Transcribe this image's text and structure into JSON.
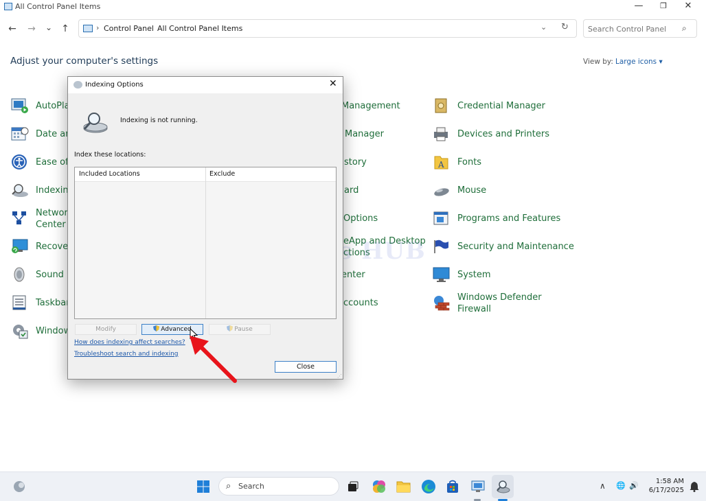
{
  "window": {
    "title": "All Control Panel Items",
    "minimize_glyph": "—",
    "maximize_glyph": "❐",
    "close_glyph": "✕"
  },
  "nav": {
    "back_glyph": "←",
    "forward_glyph": "→",
    "recent_glyph": "⌄",
    "up_glyph": "↑",
    "separator": "›",
    "breadcrumb": [
      "Control Panel",
      "All Control Panel Items"
    ],
    "dropdown_glyph": "⌄",
    "refresh_glyph": "↻",
    "search_placeholder": "Search Control Panel",
    "search_glyph": "⌕"
  },
  "header": {
    "title": "Adjust your computer's settings",
    "view_by_label": "View by:",
    "view_by_value": "Large icons ▾"
  },
  "items_left": [
    "AutoPlay",
    "Date and",
    "Ease of A",
    "Indexing",
    "Network\nCenter",
    "Recover",
    "Sound",
    "Taskbar a",
    "Window"
  ],
  "items_middle": [
    "Management",
    "Manager",
    "story",
    "ard",
    "Options",
    "eApp and Desktop\nctions",
    "enter",
    "ccounts"
  ],
  "items_right": [
    "Credential Manager",
    "Devices and Printers",
    "Fonts",
    "Mouse",
    "Programs and Features",
    "Security and Maintenance",
    "System",
    "Windows Defender\nFirewall"
  ],
  "watermark": "IT Pros HUB",
  "dialog": {
    "title": "Indexing Options",
    "close_glyph": "✕",
    "status": "Indexing is not running.",
    "index_label": "Index these locations:",
    "columns": [
      "Included Locations",
      "Exclude"
    ],
    "buttons": {
      "modify": "Modify",
      "advanced": "Advanced",
      "pause": "Pause",
      "close": "Close"
    },
    "links": [
      "How does indexing affect searches?",
      "Troubleshoot search and indexing"
    ]
  },
  "taskbar": {
    "search_glyph": "⌕",
    "search_label": "Search",
    "tray_chevron": "∧",
    "tray_network": "🌐",
    "tray_volume": "🔊",
    "time": "1:58 AM",
    "date": "6/17/2025"
  },
  "colors": {
    "item_link": "#1f6e3a",
    "accent": "#3a7fc6",
    "arrow": "#e8141b"
  }
}
